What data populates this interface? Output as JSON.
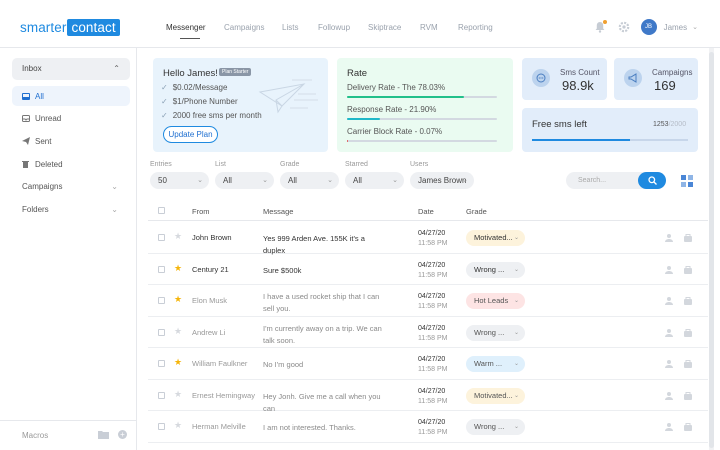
{
  "app": {
    "logo_left": "smarter",
    "logo_right": "contact"
  },
  "nav": [
    "Messenger",
    "Campaigns",
    "Lists",
    "Followup",
    "Skiptrace",
    "RVM",
    "Reporting"
  ],
  "user": {
    "initials": "JB",
    "name": "James"
  },
  "sidebar": {
    "inbox": "Inbox",
    "items": [
      {
        "label": "All",
        "icon": "inbox-icon"
      },
      {
        "label": "Unread",
        "icon": "mail-icon"
      },
      {
        "label": "Sent",
        "icon": "send-icon"
      },
      {
        "label": "Deleted",
        "icon": "trash-icon"
      }
    ],
    "campaigns": "Campaigns",
    "folders": "Folders",
    "macros": "Macros"
  },
  "hello": {
    "title": "Hello James!",
    "badge": "Plan Starter",
    "features": [
      "$0.02/Message",
      "$1/Phone Number",
      "2000 free sms per month"
    ],
    "button": "Update Plan"
  },
  "rate": {
    "title": "Rate",
    "rows": [
      {
        "label": "Delivery Rate - The 78.03%",
        "value": 78.03,
        "color": "#22c08a"
      },
      {
        "label": "Response Rate - 21.90%",
        "value": 21.9,
        "color": "#1fb8c8"
      },
      {
        "label": "Carrier Block Rate - 0.07%",
        "value": 0.07,
        "color": "#e05a5a"
      }
    ]
  },
  "sms_count": {
    "label": "Sms Count",
    "value": "98.9k"
  },
  "campaigns": {
    "label": "Campaigns",
    "value": "169"
  },
  "free_sms": {
    "label": "Free sms left",
    "value": "1253",
    "total": "/2000",
    "fraction": 0.6265
  },
  "filters": {
    "entries": {
      "label": "Entries",
      "value": "50"
    },
    "list": {
      "label": "List",
      "value": "All"
    },
    "grade": {
      "label": "Grade",
      "value": "All"
    },
    "starred": {
      "label": "Starred",
      "value": "All"
    },
    "users": {
      "label": "Users",
      "value": "James Brown"
    },
    "search_placeholder": "Search..."
  },
  "table": {
    "headers": {
      "from": "From",
      "message": "Message",
      "date": "Date",
      "grade": "Grade"
    },
    "rows": [
      {
        "from": "John Brown",
        "message": "Yes 999 Arden Ave. 155K it's a duplex",
        "date": "04/27/20",
        "time": "11:58 PM",
        "grade": "Motivated...",
        "grade_color": "#fdf3dc",
        "starred": false,
        "unread": true
      },
      {
        "from": "Century 21",
        "message": "Sure $500k",
        "date": "04/27/20",
        "time": "11:58 PM",
        "grade": "Wrong ...",
        "grade_color": "#eef0f3",
        "starred": true,
        "unread": true
      },
      {
        "from": "Elon Musk",
        "message": "I have a used rocket ship that I can sell you.",
        "date": "04/27/20",
        "time": "11:58 PM",
        "grade": "Hot Leads",
        "grade_color": "#fde4e4",
        "starred": true,
        "unread": false
      },
      {
        "from": "Andrew Li",
        "message": "I'm currently away on a trip. We can talk soon.",
        "date": "04/27/20",
        "time": "11:58 PM",
        "grade": "Wrong ...",
        "grade_color": "#eef0f3",
        "starred": false,
        "unread": false
      },
      {
        "from": "William Faulkner",
        "message": "No I'm good",
        "date": "04/27/20",
        "time": "11:58 PM",
        "grade": "Warm ...",
        "grade_color": "#dff0fc",
        "starred": true,
        "unread": false
      },
      {
        "from": "Ernest Hemingway",
        "message": "Hey Jonh. Give me a call when you can",
        "date": "04/27/20",
        "time": "11:58 PM",
        "grade": "Motivated...",
        "grade_color": "#fdf3dc",
        "starred": false,
        "unread": false
      },
      {
        "from": "Herman Melville",
        "message": "I am not interested. Thanks.",
        "date": "04/27/20",
        "time": "11:58 PM",
        "grade": "Wrong ...",
        "grade_color": "#eef0f3",
        "starred": false,
        "unread": false
      }
    ]
  }
}
